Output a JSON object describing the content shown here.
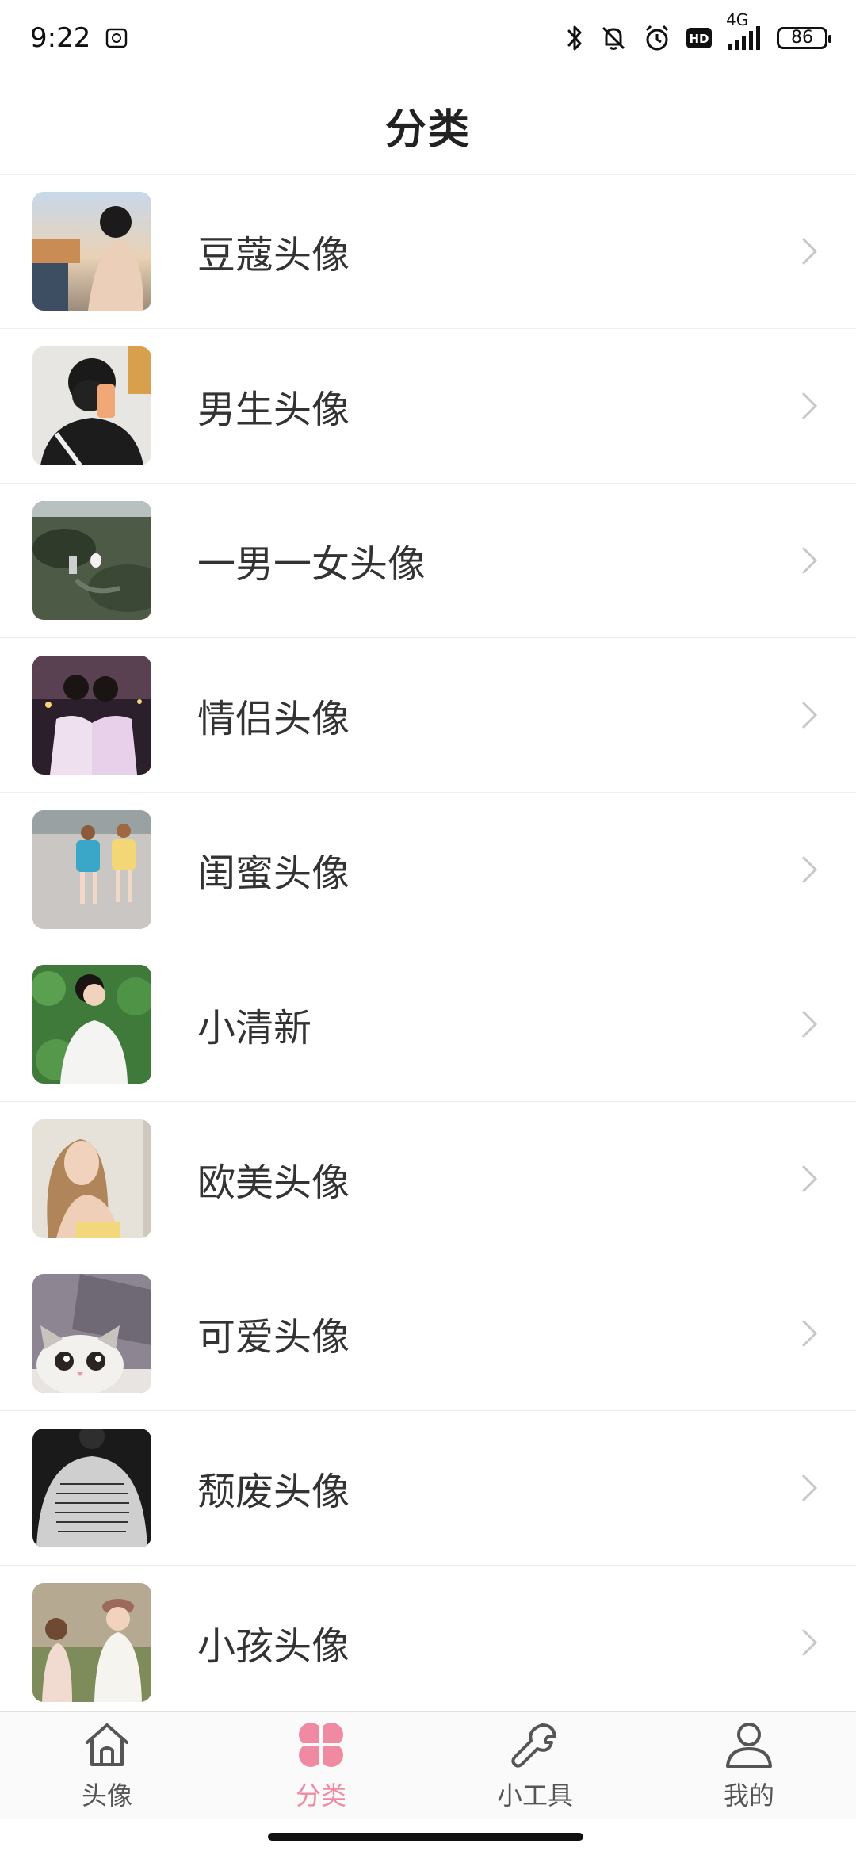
{
  "status": {
    "time": "9:22",
    "network": "4G",
    "battery": "86",
    "hd": "HD"
  },
  "header": {
    "title": "分类"
  },
  "categories": [
    {
      "label": "豆蔻头像"
    },
    {
      "label": "男生头像"
    },
    {
      "label": "一男一女头像"
    },
    {
      "label": "情侣头像"
    },
    {
      "label": "闺蜜头像"
    },
    {
      "label": "小清新"
    },
    {
      "label": "欧美头像"
    },
    {
      "label": "可爱头像"
    },
    {
      "label": "颓废头像"
    },
    {
      "label": "小孩头像"
    }
  ],
  "nav": {
    "items": [
      {
        "label": "头像",
        "icon": "home-icon"
      },
      {
        "label": "分类",
        "icon": "clover-icon"
      },
      {
        "label": "小工具",
        "icon": "wrench-icon"
      },
      {
        "label": "我的",
        "icon": "user-icon"
      }
    ],
    "active_index": 1
  },
  "colors": {
    "accent": "#f08aa3",
    "text": "#333333",
    "divider": "#eeeeee",
    "chevron": "#c8c8c8"
  }
}
